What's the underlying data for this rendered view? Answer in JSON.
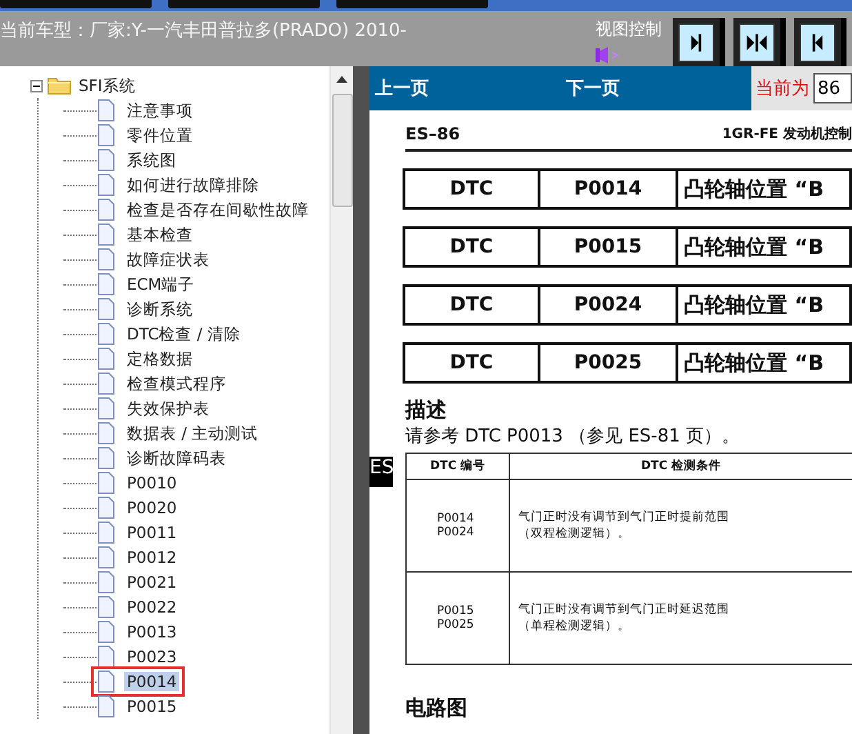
{
  "header": {
    "vehicle": "当前车型：厂家:Y-一汽丰田普拉多(PRADO) 2010-",
    "view_control_label": "视图控制"
  },
  "tree": {
    "folder": {
      "label": "SFI系统",
      "expanded": true
    },
    "items": [
      {
        "label": "注意事项",
        "selected": false,
        "marked": false
      },
      {
        "label": "零件位置",
        "selected": false,
        "marked": false
      },
      {
        "label": "系统图",
        "selected": false,
        "marked": false
      },
      {
        "label": "如何进行故障排除",
        "selected": false,
        "marked": false
      },
      {
        "label": "检查是否存在间歇性故障",
        "selected": false,
        "marked": false
      },
      {
        "label": "基本检查",
        "selected": false,
        "marked": false
      },
      {
        "label": "故障症状表",
        "selected": false,
        "marked": false
      },
      {
        "label": "ECM端子",
        "selected": false,
        "marked": false
      },
      {
        "label": "诊断系统",
        "selected": false,
        "marked": false
      },
      {
        "label": "DTC检查 / 清除",
        "selected": false,
        "marked": false
      },
      {
        "label": "定格数据",
        "selected": false,
        "marked": false
      },
      {
        "label": "检查模式程序",
        "selected": false,
        "marked": false
      },
      {
        "label": "失效保护表",
        "selected": false,
        "marked": false
      },
      {
        "label": "数据表 / 主动测试",
        "selected": false,
        "marked": false
      },
      {
        "label": "诊断故障码表",
        "selected": false,
        "marked": false
      },
      {
        "label": "P0010",
        "selected": false,
        "marked": false
      },
      {
        "label": "P0020",
        "selected": false,
        "marked": false
      },
      {
        "label": "P0011",
        "selected": false,
        "marked": false
      },
      {
        "label": "P0012",
        "selected": false,
        "marked": false
      },
      {
        "label": "P0021",
        "selected": false,
        "marked": false
      },
      {
        "label": "P0022",
        "selected": false,
        "marked": false
      },
      {
        "label": "P0013",
        "selected": false,
        "marked": false
      },
      {
        "label": "P0023",
        "selected": false,
        "marked": false
      },
      {
        "label": "P0014",
        "selected": true,
        "marked": true
      },
      {
        "label": "P0015",
        "selected": false,
        "marked": false
      }
    ]
  },
  "nav": {
    "prev": "上一页",
    "next": "下一页",
    "current_label": "当前为",
    "current_page": "86"
  },
  "document": {
    "page_no": "ES–86",
    "section": "1GR-FE 发动机控制",
    "dtc_rows": [
      [
        "DTC",
        "P0014",
        "凸轮轴位置 “B"
      ],
      [
        "DTC",
        "P0015",
        "凸轮轴位置 “B"
      ],
      [
        "DTC",
        "P0024",
        "凸轮轴位置 “B"
      ],
      [
        "DTC",
        "P0025",
        "凸轮轴位置 “B"
      ]
    ],
    "description_heading": "描述",
    "description": "请参考 DTC P0013 （参见 ES-81 页）。",
    "side_tab": "ES",
    "table": {
      "columns": [
        "DTC 编号",
        "DTC 检测条件"
      ],
      "rows": [
        {
          "codes": [
            "P0014",
            "P0024"
          ],
          "condition": [
            "气门正时没有调节到气门正时提前范围",
            "（双程检测逻辑）。"
          ]
        },
        {
          "codes": [
            "P0015",
            "P0025"
          ],
          "condition": [
            "气门正时没有调节到气门正时延迟范围",
            "（单程检测逻辑）。"
          ]
        }
      ]
    },
    "circuit_heading": "电路图"
  }
}
